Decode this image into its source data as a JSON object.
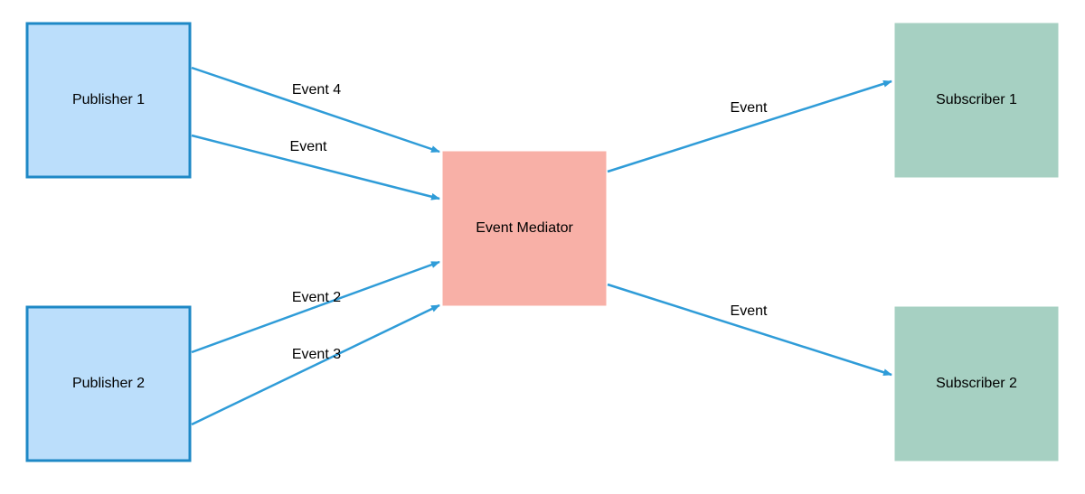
{
  "nodes": {
    "publisher1": {
      "label": "Publisher 1"
    },
    "publisher2": {
      "label": "Publisher 2"
    },
    "mediator": {
      "label": "Event Mediator"
    },
    "subscriber1": {
      "label": "Subscriber 1"
    },
    "subscriber2": {
      "label": "Subscriber 2"
    }
  },
  "edges": {
    "p1_top": {
      "label": "Event 4"
    },
    "p1_bottom": {
      "label": "Event"
    },
    "p2_top": {
      "label": "Event 2"
    },
    "p2_bottom": {
      "label": "Event 3"
    },
    "m_s1": {
      "label": "Event"
    },
    "m_s2": {
      "label": "Event"
    }
  },
  "colors": {
    "publisher_fill": "#bbdefb",
    "publisher_stroke": "#1e88c6",
    "mediator_fill": "#f8b0a7",
    "subscriber_fill": "#a6d0c2",
    "arrow": "#2f9cd8"
  }
}
